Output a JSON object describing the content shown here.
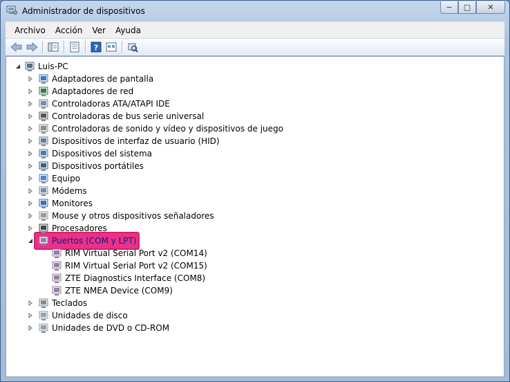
{
  "window": {
    "title": "Administrador de dispositivos",
    "controls": {
      "minimize": "−",
      "maximize": "□",
      "close": "✕"
    }
  },
  "menu": [
    "Archivo",
    "Acción",
    "Ver",
    "Ayuda"
  ],
  "toolbar": {
    "buttons": [
      "back-arrow-icon",
      "forward-arrow-icon",
      "show-hide-tree-icon",
      "properties-icon",
      "help-icon",
      "update-driver-icon",
      "scan-hardware-icon"
    ]
  },
  "tree": {
    "root": "Luis-PC",
    "categories": [
      {
        "label": "Adaptadores de pantalla",
        "icon": "display-adapter-icon"
      },
      {
        "label": "Adaptadores de red",
        "icon": "network-adapter-icon"
      },
      {
        "label": "Controladoras ATA/ATAPI IDE",
        "icon": "ide-controller-icon"
      },
      {
        "label": "Controladoras de bus serie universal",
        "icon": "usb-icon"
      },
      {
        "label": "Controladoras de sonido y vídeo y dispositivos de juego",
        "icon": "speaker-icon"
      },
      {
        "label": "Dispositivos de interfaz de usuario (HID)",
        "icon": "hid-icon"
      },
      {
        "label": "Dispositivos del sistema",
        "icon": "system-device-icon"
      },
      {
        "label": "Dispositivos portátiles",
        "icon": "portable-device-icon"
      },
      {
        "label": "Equipo",
        "icon": "computer-icon"
      },
      {
        "label": "Módems",
        "icon": "modem-icon"
      },
      {
        "label": "Monitores",
        "icon": "monitor-icon"
      },
      {
        "label": "Mouse y otros dispositivos señaladores",
        "icon": "mouse-icon"
      },
      {
        "label": "Procesadores",
        "icon": "processor-icon"
      },
      {
        "label": "Puertos (COM y LPT)",
        "icon": "port-icon",
        "expanded": true,
        "selected": true
      },
      {
        "label": "Teclados",
        "icon": "keyboard-icon"
      },
      {
        "label": "Unidades de disco",
        "icon": "disk-drive-icon"
      },
      {
        "label": "Unidades de DVD o CD-ROM",
        "icon": "dvd-drive-icon"
      }
    ],
    "ports": [
      "RIM Virtual Serial Port v2 (COM14)",
      "RIM Virtual Serial Port v2 (COM15)",
      "ZTE Diagnostics Interface (COM8)",
      "ZTE NMEA Device (COM9)"
    ]
  },
  "colors": {
    "highlight": "#e8318a",
    "highlight_border": "#d81f66"
  }
}
